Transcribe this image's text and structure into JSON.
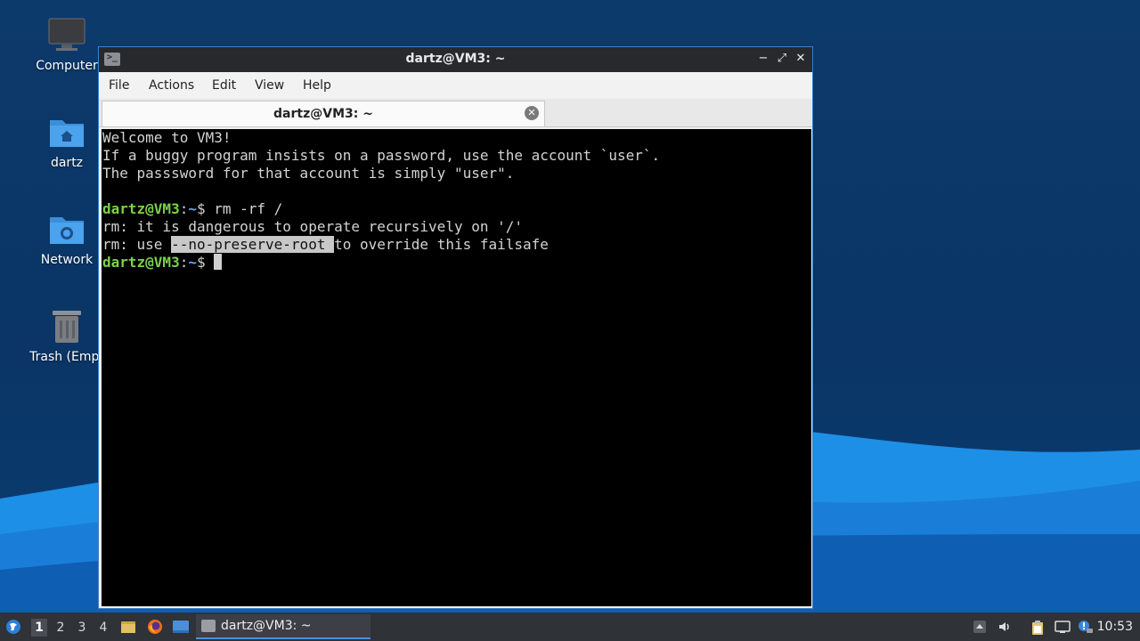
{
  "desktop": {
    "icons": [
      {
        "label": "Computer",
        "icon": "monitor-icon"
      },
      {
        "label": "dartz",
        "icon": "home-folder-icon"
      },
      {
        "label": "Network",
        "icon": "network-folder-icon"
      },
      {
        "label": "Trash (Empt",
        "icon": "trash-icon"
      }
    ]
  },
  "window": {
    "title": "dartz@VM3: ~",
    "controls": {
      "minimize": "−",
      "maximize": "⤢",
      "close": "✕"
    },
    "menu": [
      "File",
      "Actions",
      "Edit",
      "View",
      "Help"
    ],
    "tab": {
      "label": "dartz@VM3: ~",
      "close": "✕"
    }
  },
  "terminal": {
    "welcome": [
      "Welcome to VM3!",
      "If a buggy program insists on a password, use the account `user`.",
      "The passsword for that account is simply \"user\"."
    ],
    "prompt_user": "dartz@VM3",
    "prompt_sep": ":",
    "prompt_path": "~",
    "prompt_end": "$ ",
    "command": "rm -rf /",
    "output1": "rm: it is dangerous to operate recursively on '/'",
    "output2_pre": "rm: use ",
    "output2_sel": "--no-preserve-root ",
    "output2_post": "to override this failsafe"
  },
  "taskbar": {
    "workspaces": [
      "1",
      "2",
      "3",
      "4"
    ],
    "active_workspace": "1",
    "task_label": "dartz@VM3: ~",
    "clock": "10:53"
  },
  "colors": {
    "accent": "#3d7fc8",
    "prompt_green": "#7bd14a",
    "prompt_blue": "#5ea6ff"
  }
}
